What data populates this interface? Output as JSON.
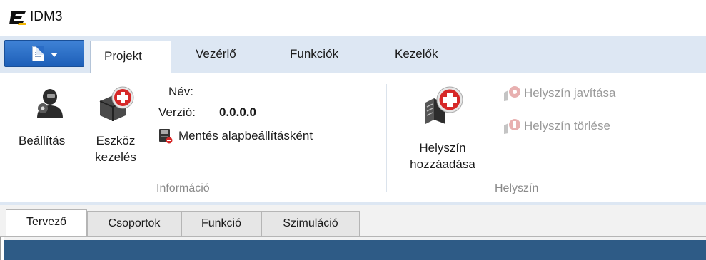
{
  "window": {
    "title": "IDM3"
  },
  "ribbon_tabs": [
    {
      "label": "Projekt",
      "active": true
    },
    {
      "label": "Vezérlő",
      "active": false
    },
    {
      "label": "Funkciók",
      "active": false
    },
    {
      "label": "Kezelők",
      "active": false
    }
  ],
  "info_group": {
    "caption": "Információ",
    "settings_label": "Beállítás",
    "device_label_line1": "Eszköz",
    "device_label_line2": "kezelés",
    "name_label": "Név:",
    "name_value": "",
    "version_label": "Verzió:",
    "version_value": "0.0.0.0",
    "save_default_label": "Mentés alapbeállításként"
  },
  "location_group": {
    "caption": "Helyszín",
    "add_label_line1": "Helyszín",
    "add_label_line2": "hozzáadása",
    "fix_label": "Helyszín javítása",
    "delete_label": "Helyszín törlése",
    "fix_enabled": false,
    "delete_enabled": false
  },
  "doc_tabs": [
    {
      "label": "Tervező",
      "active": true
    },
    {
      "label": "Csoportok",
      "active": false
    },
    {
      "label": "Funkció",
      "active": false
    },
    {
      "label": "Szimuláció",
      "active": false
    }
  ],
  "colors": {
    "ribbon_bg": "#dde7f3",
    "app_button": "#2a6cc6",
    "canvas": "#2e5b86",
    "add_icon_red": "#d62828"
  }
}
